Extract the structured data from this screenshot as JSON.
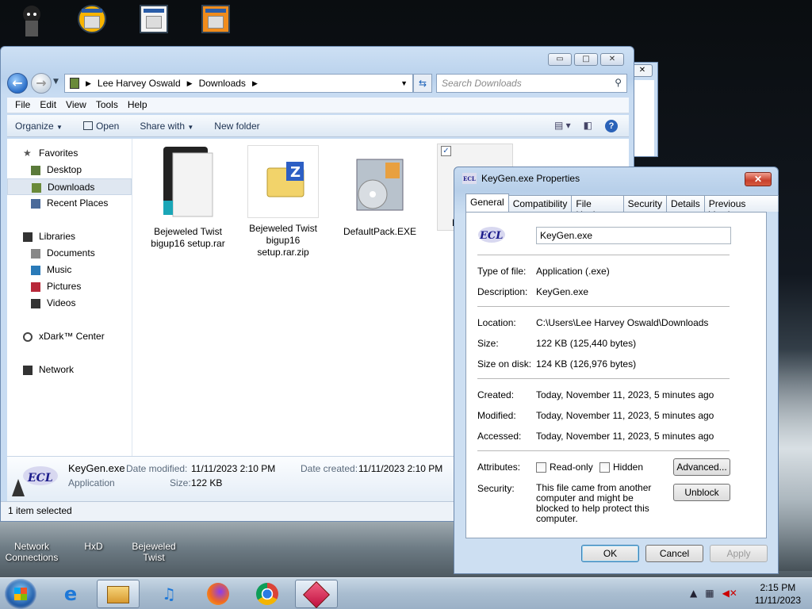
{
  "desktop": {
    "bottom_icons": [
      {
        "label": "Network\nConnections"
      },
      {
        "label": "HxD"
      },
      {
        "label": "Bejeweled\nTwist"
      }
    ]
  },
  "explorer": {
    "window_buttons": {
      "minimize": "▭",
      "maximize": "□",
      "close": "✕"
    },
    "breadcrumb": [
      "Lee Harvey Oswald",
      "Downloads"
    ],
    "search_placeholder": "Search Downloads",
    "menu": [
      "File",
      "Edit",
      "View",
      "Tools",
      "Help"
    ],
    "commands": {
      "organize": "Organize",
      "open": "Open",
      "share_with": "Share with",
      "new_folder": "New folder"
    },
    "sidebar": {
      "favorites": {
        "label": "Favorites",
        "items": [
          "Desktop",
          "Downloads",
          "Recent Places"
        ]
      },
      "libraries": {
        "label": "Libraries",
        "items": [
          "Documents",
          "Music",
          "Pictures",
          "Videos"
        ]
      },
      "xdark": "xDark™ Center",
      "network": "Network"
    },
    "files": [
      {
        "name": "Bejeweled Twist bigup16 setup.rar"
      },
      {
        "name": "Bejeweled Twist bigup16 setup.rar.zip"
      },
      {
        "name": "DefaultPack.EXE"
      },
      {
        "name": "K"
      }
    ],
    "details": {
      "name": "KeyGen.exe",
      "type": "Application",
      "date_modified_label": "Date modified:",
      "date_modified": "11/11/2023 2:10 PM",
      "date_created_label": "Date created:",
      "date_created": "11/11/2023 2:10 PM",
      "size_label": "Size:",
      "size": "122 KB"
    },
    "status": "1 item selected"
  },
  "properties": {
    "title": "KeyGen.exe Properties",
    "tabs": [
      "General",
      "Compatibility",
      "File Hashes",
      "Security",
      "Details",
      "Previous Versions"
    ],
    "filename": "KeyGen.exe",
    "fields": {
      "type_label": "Type of file:",
      "type": "Application (.exe)",
      "desc_label": "Description:",
      "desc": "KeyGen.exe",
      "location_label": "Location:",
      "location": "C:\\Users\\Lee Harvey Oswald\\Downloads",
      "size_label": "Size:",
      "size": "122 KB (125,440 bytes)",
      "sizedisk_label": "Size on disk:",
      "sizedisk": "124 KB (126,976 bytes)",
      "created_label": "Created:",
      "created": "Today, November 11, 2023, 5 minutes ago",
      "modified_label": "Modified:",
      "modified": "Today, November 11, 2023, 5 minutes ago",
      "accessed_label": "Accessed:",
      "accessed": "Today, November 11, 2023, 5 minutes ago",
      "attributes_label": "Attributes:",
      "readonly": "Read-only",
      "hidden": "Hidden",
      "advanced": "Advanced...",
      "security_label": "Security:",
      "security_text": "This file came from another computer and might be blocked to help protect this computer.",
      "unblock": "Unblock"
    },
    "buttons": {
      "ok": "OK",
      "cancel": "Cancel",
      "apply": "Apply"
    },
    "logo_text": "ECL"
  },
  "taskbar": {
    "time": "2:15 PM",
    "date": "11/11/2023"
  }
}
